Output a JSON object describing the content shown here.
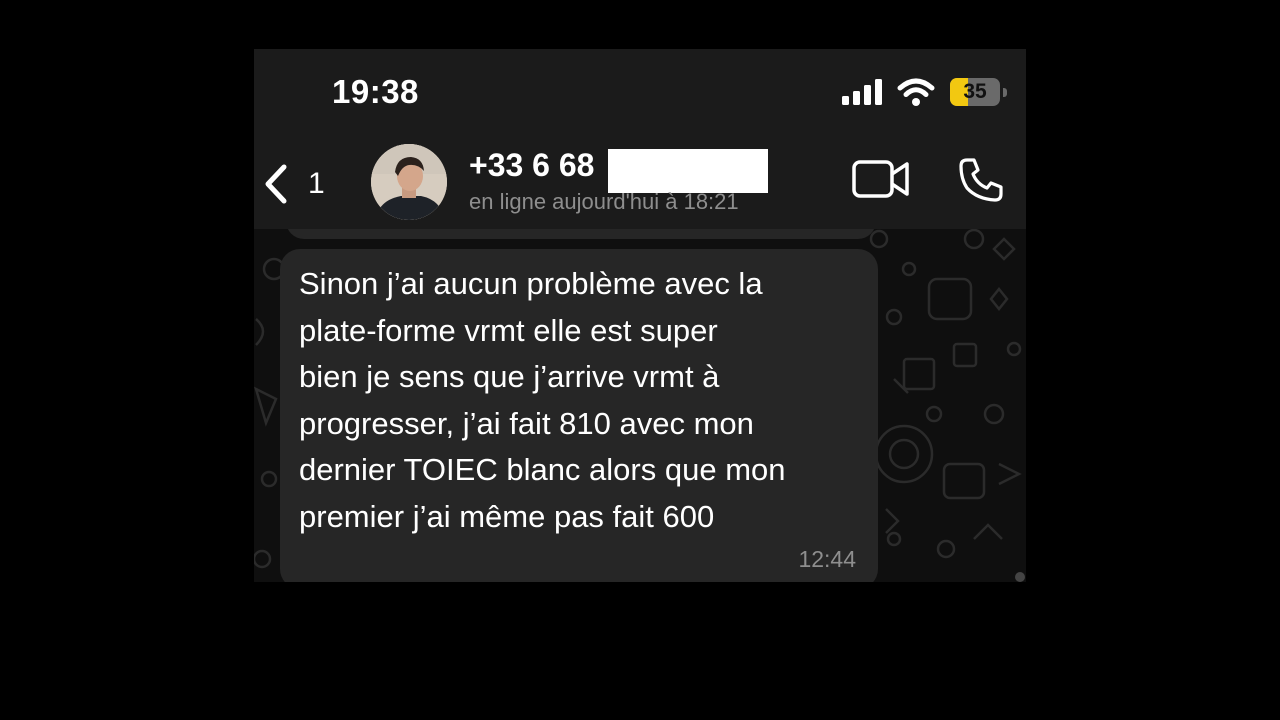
{
  "status_bar": {
    "time": "19:38",
    "battery_level": "35",
    "battery_fraction": 0.35,
    "icons": [
      "signal-icon",
      "wifi-icon",
      "battery-icon"
    ]
  },
  "header": {
    "back_count": "1",
    "contact_name": "+33 6 68",
    "contact_status": "en ligne aujourd'hui à 18:21",
    "icons": [
      "back-chevron-icon",
      "avatar",
      "video-call-icon",
      "phone-icon"
    ]
  },
  "message": {
    "text": "Sinon j’ai aucun problème avec la\nplate-forme vrmt elle est super\nbien je sens que j’arrive vrmt à\nprogresser, j’ai fait 810 avec mon\ndernier TOIEC blanc alors que mon\npremier j’ai même pas fait 600",
    "time": "12:44"
  },
  "colors": {
    "background": "#000000",
    "bar": "#1b1b1b",
    "chat_bg": "#0f0f0f",
    "bubble": "#262626",
    "battery_accent": "#f2c811",
    "muted_text": "#8e8e8e"
  }
}
